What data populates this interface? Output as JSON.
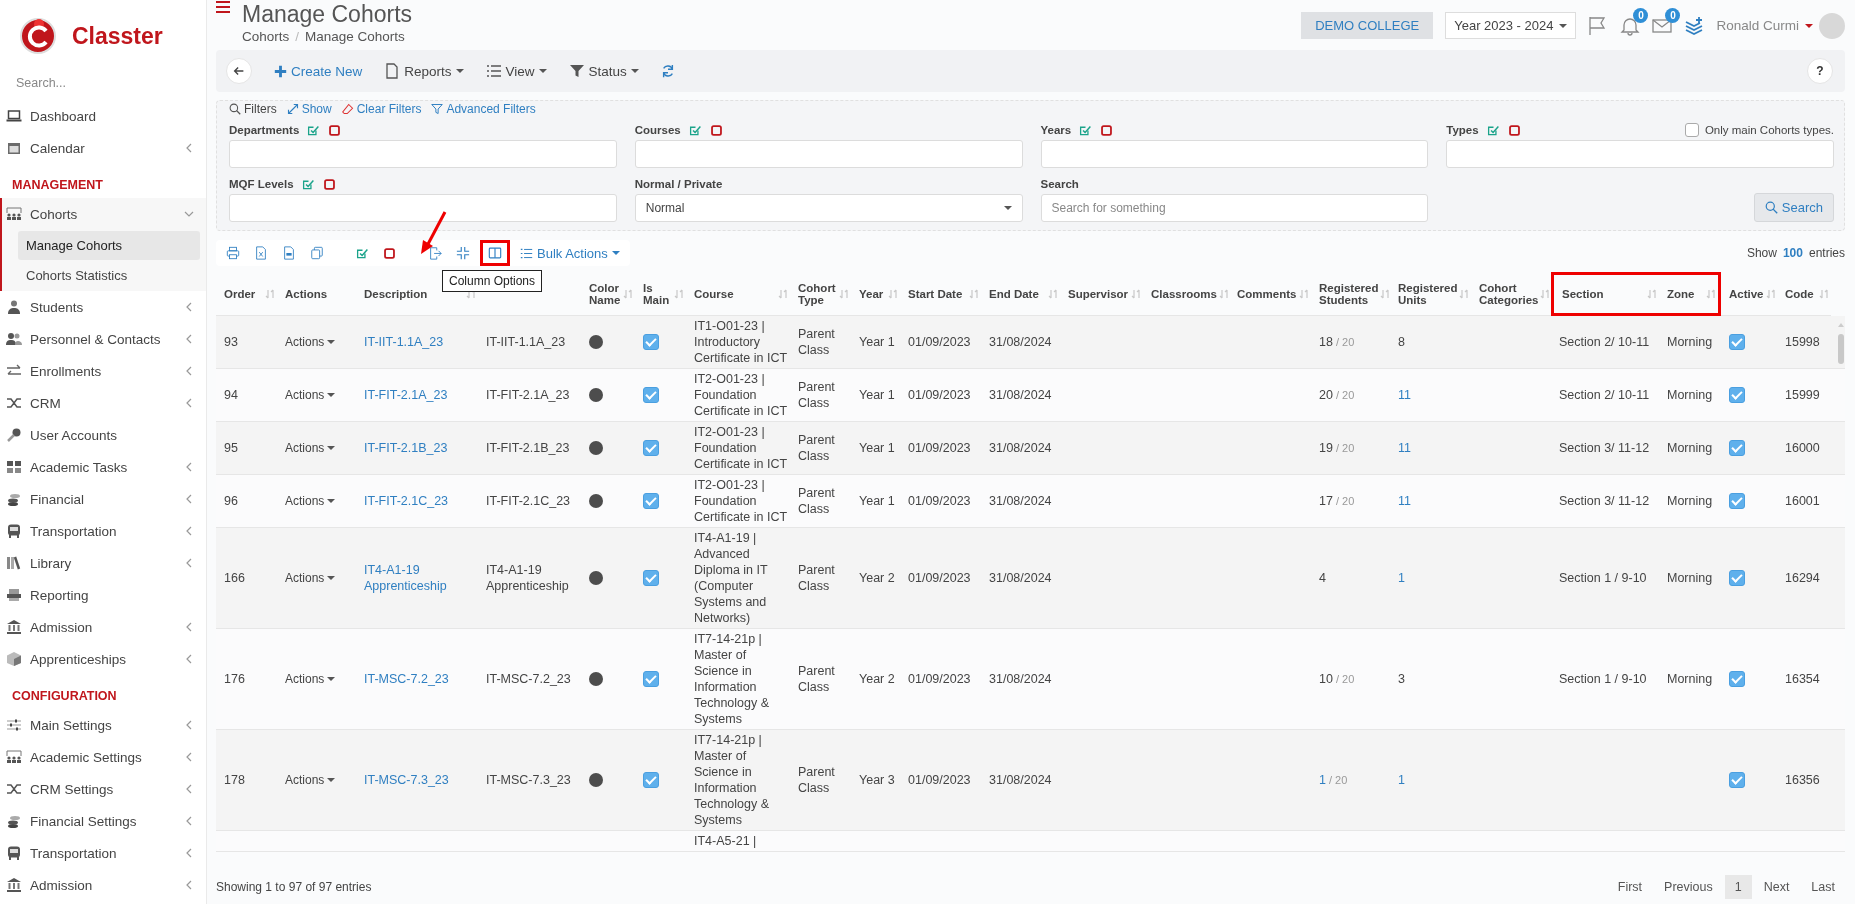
{
  "brand": {
    "name": "Classter"
  },
  "sidebar": {
    "search_placeholder": "Search...",
    "items": [
      {
        "kind": "item",
        "label": "Dashboard",
        "has_submenu": false,
        "expanded": false
      },
      {
        "kind": "item",
        "label": "Calendar",
        "has_submenu": true,
        "expanded": false
      },
      {
        "kind": "heading",
        "label": "MANAGEMENT"
      },
      {
        "kind": "item",
        "label": "Cohorts",
        "has_submenu": true,
        "expanded": true,
        "children": [
          {
            "label": "Manage Cohorts",
            "selected": true
          },
          {
            "label": "Cohorts Statistics",
            "selected": false
          }
        ]
      },
      {
        "kind": "item",
        "label": "Students",
        "has_submenu": true,
        "expanded": false
      },
      {
        "kind": "item",
        "label": "Personnel & Contacts",
        "has_submenu": true,
        "expanded": false
      },
      {
        "kind": "item",
        "label": "Enrollments",
        "has_submenu": true,
        "expanded": false
      },
      {
        "kind": "item",
        "label": "CRM",
        "has_submenu": true,
        "expanded": false
      },
      {
        "kind": "item",
        "label": "User Accounts",
        "has_submenu": false,
        "expanded": false
      },
      {
        "kind": "item",
        "label": "Academic Tasks",
        "has_submenu": true,
        "expanded": false
      },
      {
        "kind": "item",
        "label": "Financial",
        "has_submenu": true,
        "expanded": false
      },
      {
        "kind": "item",
        "label": "Transportation",
        "has_submenu": true,
        "expanded": false
      },
      {
        "kind": "item",
        "label": "Library",
        "has_submenu": true,
        "expanded": false
      },
      {
        "kind": "item",
        "label": "Reporting",
        "has_submenu": false,
        "expanded": false
      },
      {
        "kind": "item",
        "label": "Admission",
        "has_submenu": true,
        "expanded": false
      },
      {
        "kind": "item",
        "label": "Apprenticeships",
        "has_submenu": true,
        "expanded": false
      },
      {
        "kind": "heading",
        "label": "CONFIGURATION"
      },
      {
        "kind": "item",
        "label": "Main Settings",
        "has_submenu": true,
        "expanded": false
      },
      {
        "kind": "item",
        "label": "Academic Settings",
        "has_submenu": true,
        "expanded": false
      },
      {
        "kind": "item",
        "label": "CRM Settings",
        "has_submenu": true,
        "expanded": false
      },
      {
        "kind": "item",
        "label": "Financial Settings",
        "has_submenu": true,
        "expanded": false
      },
      {
        "kind": "item",
        "label": "Transportation",
        "has_submenu": true,
        "expanded": false
      },
      {
        "kind": "item",
        "label": "Admission",
        "has_submenu": true,
        "expanded": false
      }
    ]
  },
  "header": {
    "title": "Manage Cohorts",
    "breadcrumb": [
      "Cohorts",
      "Manage Cohorts"
    ],
    "breadcrumb_separator": "/",
    "school": "DEMO COLLEGE",
    "year": "Year 2023 - 2024",
    "notifications": "0",
    "messages": "0",
    "user": "Ronald Curmi"
  },
  "toolbar": {
    "create": "Create New",
    "menus": [
      "Reports",
      "View",
      "Status"
    ],
    "help": "?"
  },
  "filters": {
    "title": "Filters",
    "links": [
      "Show",
      "Clear Filters",
      "Advanced Filters"
    ],
    "only_main_label": "Only main Cohorts types.",
    "only_main_checked": false,
    "search_button": "Search",
    "fields": [
      {
        "kind": "multi",
        "label": "Departments"
      },
      {
        "kind": "multi",
        "label": "Courses"
      },
      {
        "kind": "multi",
        "label": "Years"
      },
      {
        "kind": "multi",
        "label": "Types"
      },
      {
        "kind": "multi",
        "label": "MQF Levels"
      },
      {
        "kind": "select",
        "label": "Normal / Private",
        "value": "Normal"
      },
      {
        "kind": "text",
        "label": "Search",
        "placeholder": "Search for something"
      }
    ]
  },
  "table_toolbar": {
    "bulk": "Bulk Actions",
    "tooltip": "Column Options",
    "show": "Show",
    "page_size": "100",
    "entries": "entries"
  },
  "table": {
    "columns": [
      {
        "label": "Order",
        "sortable": true,
        "highlighted": false
      },
      {
        "label": "Actions",
        "sortable": false,
        "highlighted": false
      },
      {
        "label": "Description",
        "sortable": true,
        "highlighted": false
      },
      {
        "sortable": false,
        "highlighted": false
      },
      {
        "label": "Color Name",
        "sortable": true,
        "highlighted": false
      },
      {
        "label": "Is Main",
        "sortable": true,
        "highlighted": false
      },
      {
        "label": "Course",
        "sortable": true,
        "highlighted": false
      },
      {
        "label": "Cohort Type",
        "sortable": true,
        "highlighted": false
      },
      {
        "label": "Year",
        "sortable": true,
        "highlighted": false
      },
      {
        "label": "Start Date",
        "sortable": true,
        "highlighted": false
      },
      {
        "label": "End Date",
        "sortable": true,
        "highlighted": false
      },
      {
        "label": "Supervisor",
        "sortable": true,
        "highlighted": false
      },
      {
        "label": "Classrooms",
        "sortable": true,
        "highlighted": false
      },
      {
        "label": "Comments",
        "sortable": true,
        "highlighted": false
      },
      {
        "label": "Registered Students",
        "sortable": true,
        "highlighted": false
      },
      {
        "label": "Registered Units",
        "sortable": true,
        "highlighted": false
      },
      {
        "label": "Cohort Categories",
        "sortable": true,
        "highlighted": false
      },
      {
        "label": "Section",
        "sortable": true,
        "highlighted": true
      },
      {
        "label": "Zone",
        "sortable": true,
        "highlighted": true
      },
      {
        "label": "Active",
        "sortable": true,
        "highlighted": false
      },
      {
        "label": "Code",
        "sortable": true,
        "highlighted": false
      }
    ],
    "rows": [
      {
        "order": "93",
        "actions": "Actions",
        "description": "IT-IIT-1.1A_23",
        "column_4": "IT-IIT-1.1A_23",
        "color": "#4d4d4d",
        "is_main": true,
        "course": "IT1-O01-23 | Introductory Certificate in ICT",
        "cohort_type": "Parent Class",
        "year": "Year 1",
        "start_date": "01/09/2023",
        "end_date": "31/08/2024",
        "registered_students": "18",
        "students_link": false,
        "capacity": "/ 20",
        "registered_units": "8",
        "units_link": false,
        "section": "Section 2/ 10-11",
        "zone": "Morning",
        "active": true,
        "code": "15998"
      },
      {
        "order": "94",
        "actions": "Actions",
        "description": "IT-FIT-2.1A_23",
        "column_4": "IT-FIT-2.1A_23",
        "color": "#4d4d4d",
        "is_main": true,
        "course": "IT2-O01-23 | Foundation Certificate in ICT",
        "cohort_type": "Parent Class",
        "year": "Year 1",
        "start_date": "01/09/2023",
        "end_date": "31/08/2024",
        "registered_students": "20",
        "students_link": false,
        "capacity": "/ 20",
        "registered_units": "11",
        "units_link": true,
        "section": "Section 2/ 10-11",
        "zone": "Morning",
        "active": true,
        "code": "15999"
      },
      {
        "order": "95",
        "actions": "Actions",
        "description": "IT-FIT-2.1B_23",
        "column_4": "IT-FIT-2.1B_23",
        "color": "#4d4d4d",
        "is_main": true,
        "course": "IT2-O01-23 | Foundation Certificate in ICT",
        "cohort_type": "Parent Class",
        "year": "Year 1",
        "start_date": "01/09/2023",
        "end_date": "31/08/2024",
        "registered_students": "19",
        "students_link": false,
        "capacity": "/ 20",
        "registered_units": "11",
        "units_link": true,
        "section": "Section 3/ 11-12",
        "zone": "Morning",
        "active": true,
        "code": "16000"
      },
      {
        "order": "96",
        "actions": "Actions",
        "description": "IT-FIT-2.1C_23",
        "column_4": "IT-FIT-2.1C_23",
        "color": "#4d4d4d",
        "is_main": true,
        "course": "IT2-O01-23 | Foundation Certificate in ICT",
        "cohort_type": "Parent Class",
        "year": "Year 1",
        "start_date": "01/09/2023",
        "end_date": "31/08/2024",
        "registered_students": "17",
        "students_link": false,
        "capacity": "/ 20",
        "registered_units": "11",
        "units_link": true,
        "section": "Section 3/ 11-12",
        "zone": "Morning",
        "active": true,
        "code": "16001"
      },
      {
        "order": "166",
        "actions": "Actions",
        "description": "IT4-A1-19 Apprenticeship",
        "column_4": "IT4-A1-19 Apprenticeship",
        "color": "#4d4d4d",
        "is_main": true,
        "course": "IT4-A1-19 | Advanced Diploma in IT (Computer Systems and Networks)",
        "cohort_type": "Parent Class",
        "year": "Year 2",
        "start_date": "01/09/2023",
        "end_date": "31/08/2024",
        "registered_students": "4",
        "students_link": false,
        "registered_units": "1",
        "units_link": true,
        "section": "Section 1 / 9-10",
        "zone": "Morning",
        "active": true,
        "code": "16294"
      },
      {
        "order": "176",
        "actions": "Actions",
        "description": "IT-MSC-7.2_23",
        "column_4": "IT-MSC-7.2_23",
        "color": "#4d4d4d",
        "is_main": true,
        "course": "IT7-14-21p | Master of Science in Information Technology & Systems",
        "cohort_type": "Parent Class",
        "year": "Year 2",
        "start_date": "01/09/2023",
        "end_date": "31/08/2024",
        "registered_students": "10",
        "students_link": false,
        "capacity": "/ 20",
        "registered_units": "3",
        "units_link": false,
        "section": "Section 1 / 9-10",
        "zone": "Morning",
        "active": true,
        "code": "16354"
      },
      {
        "order": "178",
        "actions": "Actions",
        "description": "IT-MSC-7.3_23",
        "column_4": "IT-MSC-7.3_23",
        "color": "#4d4d4d",
        "is_main": true,
        "course": "IT7-14-21p | Master of Science in Information Technology & Systems",
        "cohort_type": "Parent Class",
        "year": "Year 3",
        "start_date": "01/09/2023",
        "end_date": "31/08/2024",
        "registered_students": "1",
        "students_link": true,
        "capacity": "/ 20",
        "registered_units": "1",
        "units_link": true,
        "active": true,
        "code": "16356"
      },
      {
        "course": "IT4-A5-21 |"
      }
    ]
  },
  "footer": {
    "info": "Showing 1 to 97 of 97 entries",
    "pages": [
      {
        "label": "First",
        "selected": false
      },
      {
        "label": "Previous",
        "selected": false
      },
      {
        "label": "1",
        "selected": true
      },
      {
        "label": "Next",
        "selected": false
      },
      {
        "label": "Last",
        "selected": false
      }
    ]
  }
}
